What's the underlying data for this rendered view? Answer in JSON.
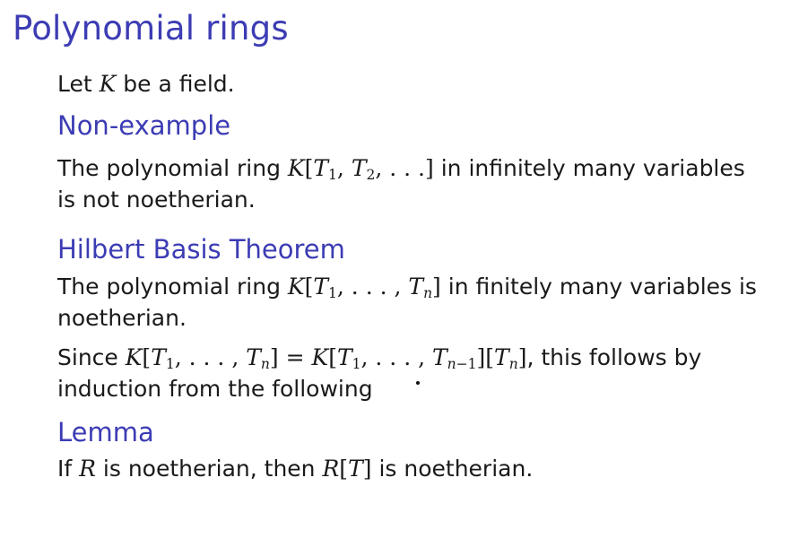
{
  "slide": {
    "title": "Polynomial rings"
  },
  "intro": {
    "before": "Let ",
    "var": "K",
    "after": " be a field."
  },
  "non_example": {
    "heading": "Non-example",
    "line1_before": "The polynomial ring ",
    "line1_after": " in infinitely many variables",
    "line2": "is not noetherian."
  },
  "hilbert": {
    "heading": "Hilbert Basis Theorem",
    "line1_before": "The polynomial ring ",
    "line1_after": " in finitely many variables is",
    "line2": "noetherian.",
    "line3_before": "Since ",
    "line3_after": ", this follows by",
    "line4": "induction from the following"
  },
  "lemma": {
    "heading": "Lemma",
    "before": "If ",
    "var_r": "R",
    "middle": " is noetherian, then ",
    "after": " is noetherian."
  }
}
